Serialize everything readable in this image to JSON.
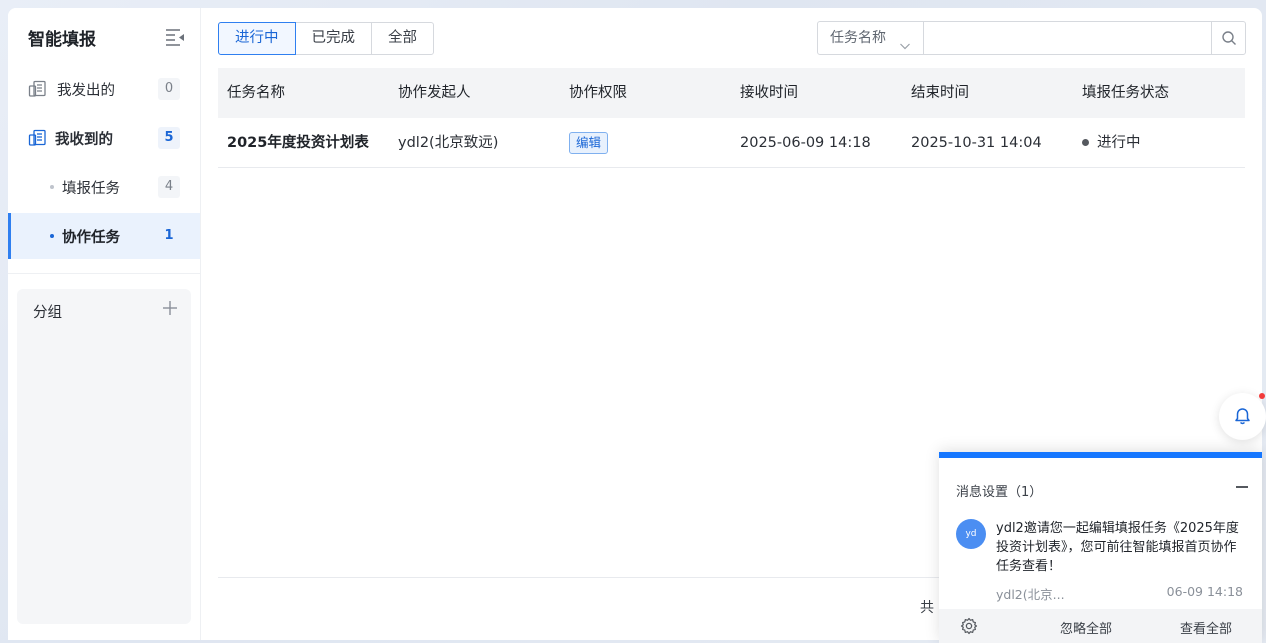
{
  "sidebar": {
    "title": "智能填报",
    "collapse_icon": "menu-collapse-icon",
    "items": [
      {
        "label": "我发出的",
        "count": "0",
        "icon": "sent-icon"
      },
      {
        "label": "我收到的",
        "count": "5",
        "icon": "received-icon"
      },
      {
        "label": "填报任务",
        "count": "4"
      },
      {
        "label": "协作任务",
        "count": "1"
      }
    ],
    "group": {
      "label": "分组",
      "add_icon": "plus-icon"
    }
  },
  "tabs": [
    {
      "label": "进行中",
      "active": true
    },
    {
      "label": "已完成",
      "active": false
    },
    {
      "label": "全部",
      "active": false
    }
  ],
  "search": {
    "field": "任务名称",
    "value": "",
    "icon": "search-icon"
  },
  "table": {
    "columns": [
      "任务名称",
      "协作发起人",
      "协作权限",
      "接收时间",
      "结束时间",
      "填报任务状态"
    ],
    "rows": [
      {
        "name": "2025年度投资计划表",
        "initiator": "ydl2(北京致远)",
        "permission": "编辑",
        "received": "2025-06-09 14:18",
        "end": "2025-10-31 14:04",
        "status": "进行中"
      }
    ]
  },
  "footer": {
    "text": "共"
  },
  "notification": {
    "title": "消息设置（1）",
    "avatar": "yd",
    "message": "ydl2邀请您一起编辑填报任务《2025年度投资计划表》，您可前往智能填报首页协作任务查看！",
    "from": "ydl2(北京...",
    "time": "06-09 14:18",
    "ignore_all": "忽略全部",
    "view_all": "查看全部",
    "settings_icon": "gear-icon",
    "bell_icon": "bell-icon"
  },
  "colors": {
    "accent": "#1677ff",
    "alert": "#f23b3b"
  }
}
